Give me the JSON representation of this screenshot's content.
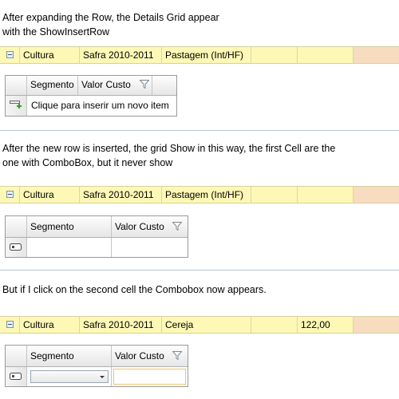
{
  "captions": {
    "c1_line1": "After expanding the Row, the Details Grid appear",
    "c1_line2": "with the ShowInsertRow",
    "c2_line1": "After the new row is inserted, the grid Show in this way, the first Cell are the",
    "c2_line2": "one with ComboBox, but it never show",
    "c3_line1": "But if I click on the second cell the Combobox now appears."
  },
  "master_rows": [
    {
      "col1": "Cultura",
      "col2": "Safra 2010-2011",
      "col3": "Pastagem (Int/HF)",
      "col5": ""
    },
    {
      "col1": "Cultura",
      "col2": "Safra 2010-2011",
      "col3": "Pastagem (Int/HF)",
      "col5": ""
    },
    {
      "col1": "Cultura",
      "col2": "Safra 2010-2011",
      "col3": "Cereja",
      "col5": "122,00"
    }
  ],
  "detail_grids": [
    {
      "col_segmento": "Segmento",
      "col_valor": "Valor Custo",
      "insert_row_text": "Clique para inserir um novo item"
    },
    {
      "col_segmento": "Segmento",
      "col_valor": "Valor Custo"
    },
    {
      "col_segmento": "Segmento",
      "col_valor": "Valor Custo"
    }
  ],
  "colors": {
    "master_row_bg": "#fdf8b6",
    "master_tail_bg": "#f7dcc0",
    "edit_border": "#f0c36d"
  },
  "icons": {
    "expander": "collapse-minus-icon",
    "filter": "filter-funnel-icon",
    "insert": "insert-row-plus-icon",
    "row_indicator": "edit-row-indicator-icon"
  }
}
